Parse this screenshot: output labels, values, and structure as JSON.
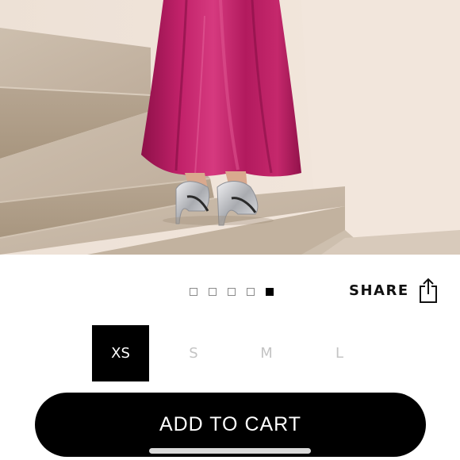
{
  "product": {
    "photo_subject": "magenta-satin-skirt-silver-heels"
  },
  "gallery": {
    "dot_count": 5,
    "active_index": 4
  },
  "share": {
    "label": "SHARE",
    "icon": "share-icon"
  },
  "sizes": {
    "options": [
      "XS",
      "S",
      "M",
      "L"
    ],
    "selected": "XS"
  },
  "cart": {
    "label": "ADD TO CART"
  },
  "colors": {
    "accent": "#000000",
    "skirt": "#b3185f",
    "inactive_text": "#c4c4c4"
  }
}
